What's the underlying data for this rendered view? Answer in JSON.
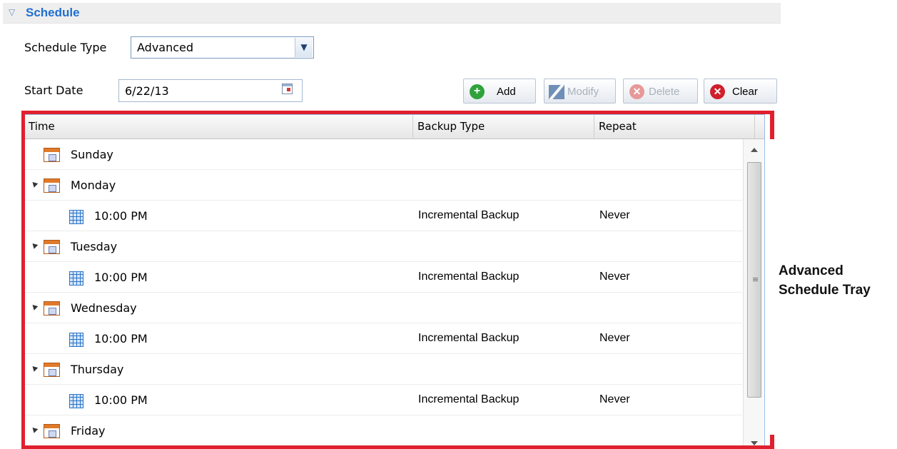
{
  "section": {
    "title": "Schedule"
  },
  "schedule_type": {
    "label": "Schedule Type",
    "value": "Advanced"
  },
  "start_date": {
    "label": "Start Date",
    "value": "6/22/13"
  },
  "toolbar": {
    "add_label": "Add",
    "modify_label": "Modify",
    "delete_label": "Delete",
    "clear_label": "Clear"
  },
  "grid": {
    "columns": [
      "Time",
      "Backup Type",
      "Repeat"
    ],
    "rows": [
      {
        "kind": "day",
        "label": "Sunday",
        "expandable": false
      },
      {
        "kind": "day",
        "label": "Monday",
        "expandable": true
      },
      {
        "kind": "time",
        "label": "10:00 PM",
        "backup_type": "Incremental Backup",
        "repeat": "Never"
      },
      {
        "kind": "day",
        "label": "Tuesday",
        "expandable": true
      },
      {
        "kind": "time",
        "label": "10:00 PM",
        "backup_type": "Incremental Backup",
        "repeat": "Never"
      },
      {
        "kind": "day",
        "label": "Wednesday",
        "expandable": true
      },
      {
        "kind": "time",
        "label": "10:00 PM",
        "backup_type": "Incremental Backup",
        "repeat": "Never"
      },
      {
        "kind": "day",
        "label": "Thursday",
        "expandable": true
      },
      {
        "kind": "time",
        "label": "10:00 PM",
        "backup_type": "Incremental Backup",
        "repeat": "Never"
      },
      {
        "kind": "day",
        "label": "Friday",
        "expandable": true
      }
    ]
  },
  "annotation": {
    "line1": "Advanced",
    "line2": "Schedule Tray"
  },
  "colors": {
    "highlight": "#e0202e",
    "section_title": "#1d6fd0"
  }
}
